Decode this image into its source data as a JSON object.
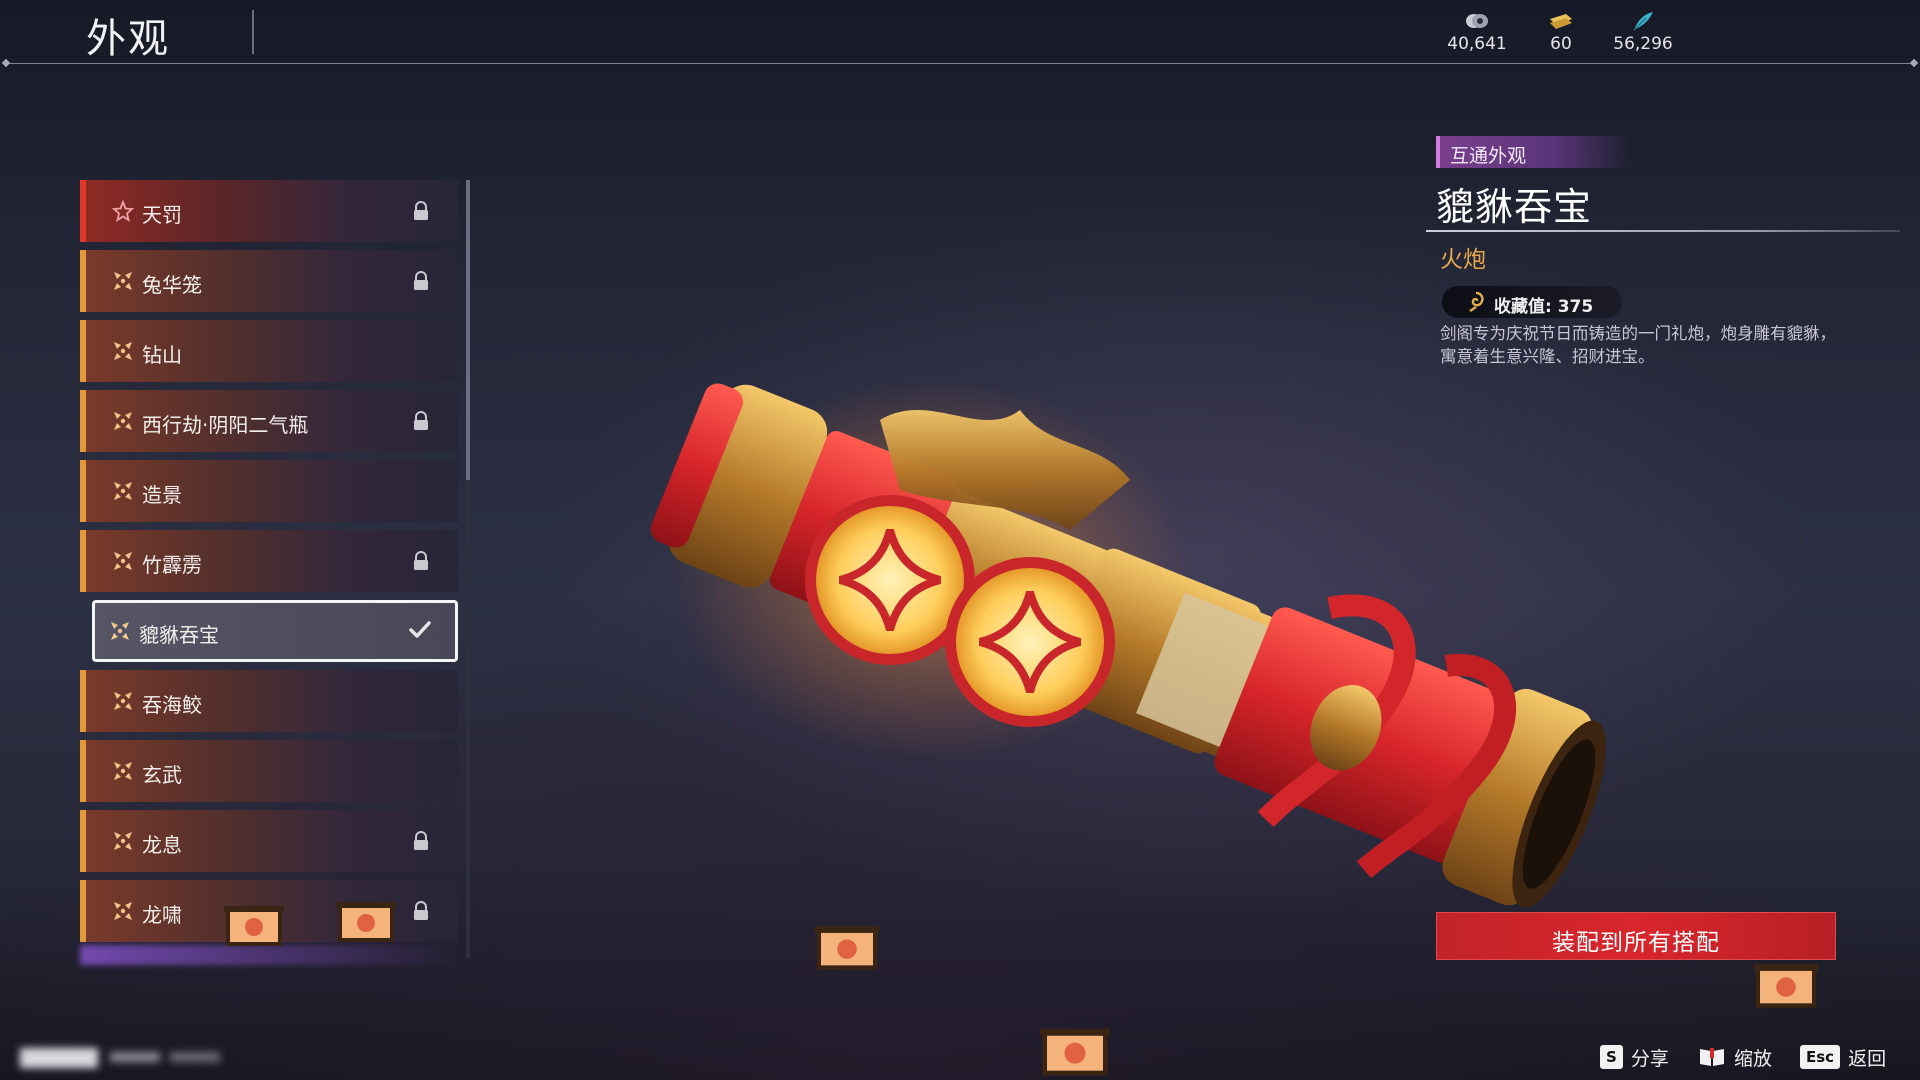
{
  "header": {
    "title": "外观",
    "currencies": [
      {
        "icon": "coin-icon",
        "value": "40,641"
      },
      {
        "icon": "ticket-icon",
        "value": "60"
      },
      {
        "icon": "feather-icon",
        "value": "56,296"
      }
    ]
  },
  "list": {
    "items": [
      {
        "label": "天罚",
        "icon": "star-icon",
        "locked": true
      },
      {
        "label": "兔华笼",
        "icon": "cross-emblem-icon",
        "locked": true
      },
      {
        "label": "钻山",
        "icon": "cross-emblem-icon",
        "locked": false
      },
      {
        "label": "西行劫·阴阳二气瓶",
        "icon": "cross-emblem-icon",
        "locked": true
      },
      {
        "label": "造景",
        "icon": "cross-emblem-icon",
        "locked": false
      },
      {
        "label": "竹霹雳",
        "icon": "cross-emblem-icon",
        "locked": true
      },
      {
        "label": "貔貅吞宝",
        "icon": "cross-emblem-icon",
        "locked": false,
        "selected": true
      },
      {
        "label": "吞海鲛",
        "icon": "cross-emblem-icon",
        "locked": false
      },
      {
        "label": "玄武",
        "icon": "cross-emblem-icon",
        "locked": false
      },
      {
        "label": "龙息",
        "icon": "cross-emblem-icon",
        "locked": true
      },
      {
        "label": "龙啸",
        "icon": "cross-emblem-icon",
        "locked": true
      }
    ]
  },
  "detail": {
    "tag": "互通外观",
    "name": "貔貅吞宝",
    "type": "火炮",
    "collect_label": "收藏值: 375",
    "description": "剑阁专为庆祝节日而铸造的一门礼炮，炮身雕有貔貅，寓意着生意兴隆、招财进宝。",
    "equip_button": "装配到所有搭配"
  },
  "footer": {
    "hints": [
      {
        "key": "S",
        "label": "分享"
      },
      {
        "key": "book-icon",
        "label": "缩放"
      },
      {
        "key": "Esc",
        "label": "返回"
      }
    ]
  },
  "colors": {
    "accent_orange": "#e19a3a",
    "accent_red": "#d8262d",
    "tag_purple": "#7a3f8c",
    "type_gold": "#e8a84a"
  }
}
